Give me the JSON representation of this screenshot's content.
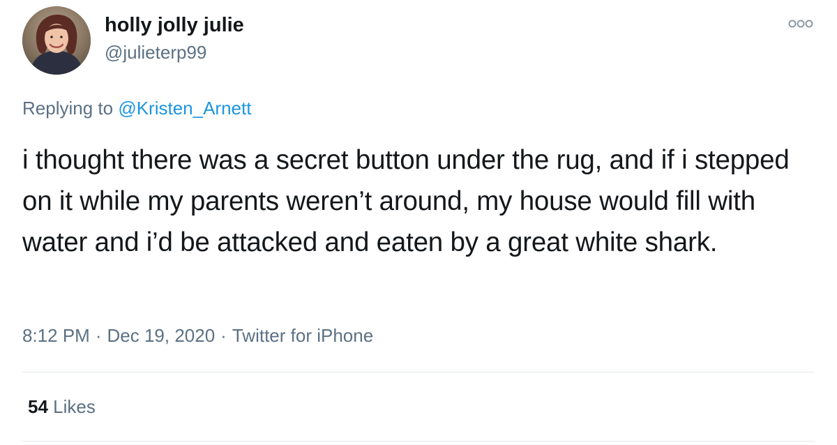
{
  "author": {
    "display_name": "holly jolly julie",
    "handle": "@julieterp99",
    "avatar_icon": "profile-photo"
  },
  "reply": {
    "prefix": "Replying to",
    "mention": "@Kristen_Arnett"
  },
  "tweet": {
    "text": "i thought there was a secret button under the rug, and if i stepped on it while my parents weren’t around, my house would fill with water and i’d be attacked and eaten by a great white shark."
  },
  "meta": {
    "time": "8:12 PM",
    "date": "Dec 19, 2020",
    "source": "Twitter for iPhone",
    "separator": "·"
  },
  "stats": {
    "likes_count": "54",
    "likes_label": "Likes"
  },
  "icons": {
    "more": "more-options-icon"
  },
  "colors": {
    "text": "#14171a",
    "secondary": "#5b7083",
    "link": "#1b95e0",
    "divider": "#e1e8ed"
  }
}
